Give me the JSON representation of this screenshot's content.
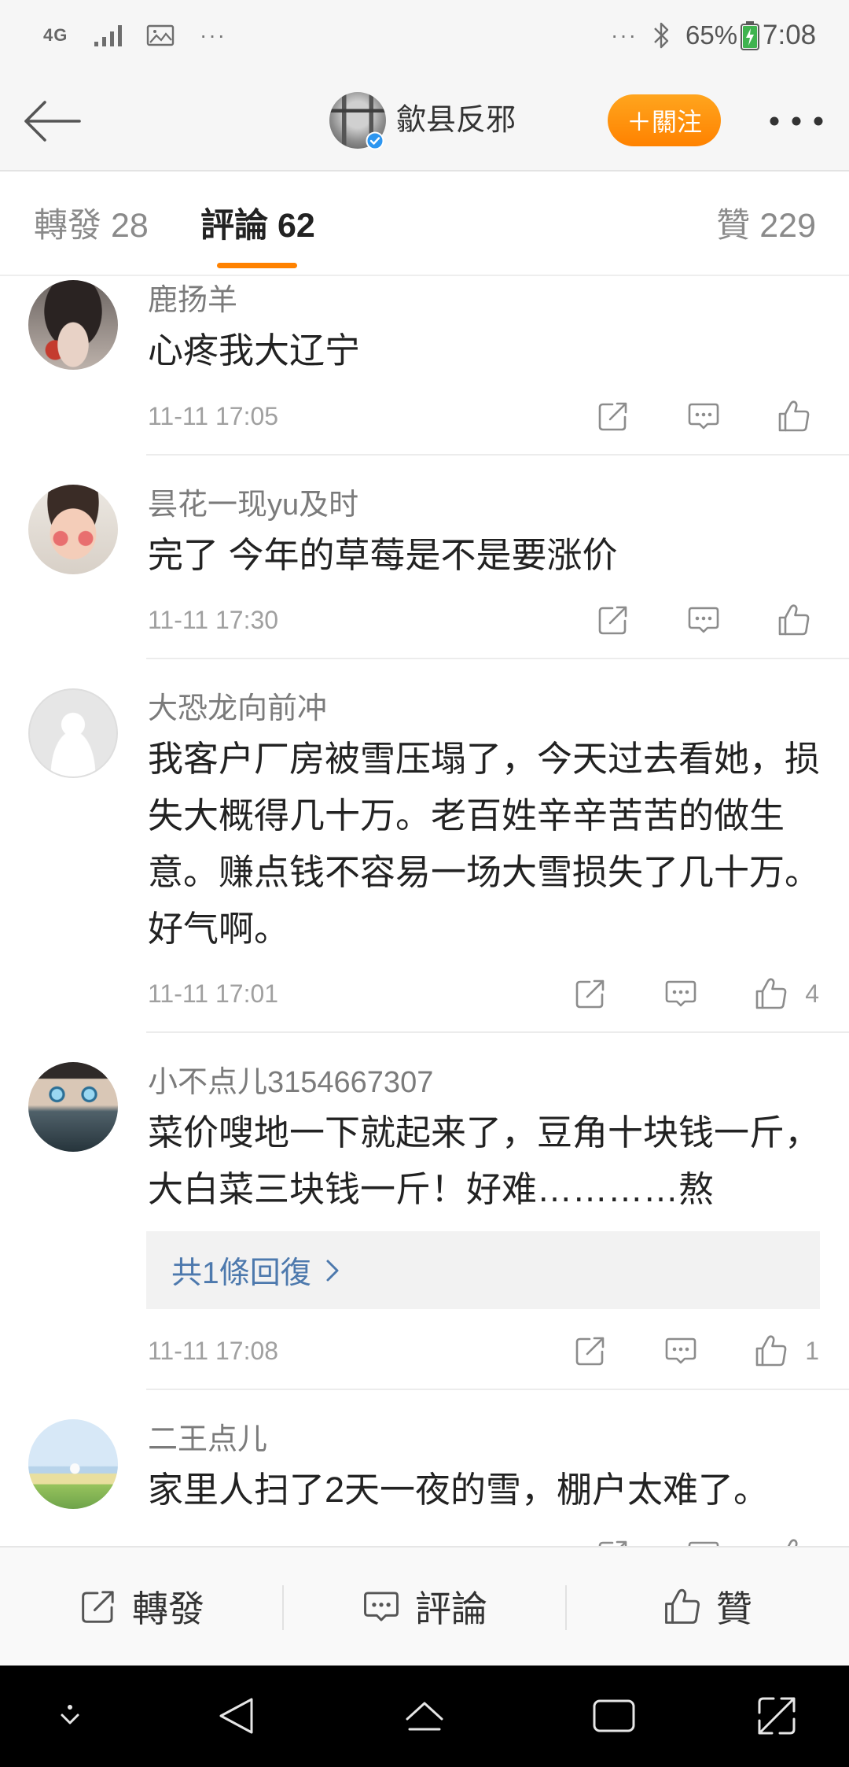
{
  "status_bar": {
    "network": "4G",
    "left_overflow": "···",
    "right_overflow": "···",
    "battery": "65%",
    "time": "7:08",
    "icons": [
      "signal-icon",
      "image-notification-icon",
      "bluetooth-icon",
      "battery-charging-icon"
    ]
  },
  "header": {
    "account_name": "歙县反邪",
    "follow_label": "＋關注",
    "verified": true,
    "icons": {
      "back": "back-arrow-icon",
      "more": "more-dots-icon",
      "verified": "verified-badge-icon"
    }
  },
  "tabs": [
    {
      "label": "轉發",
      "count": "28",
      "active": false
    },
    {
      "label": "評論",
      "count": "62",
      "active": true
    },
    {
      "label": "贊",
      "count": "229",
      "active": false
    }
  ],
  "comments": [
    {
      "name": "鹿扬羊",
      "lines": [
        "心疼我大辽宁"
      ],
      "time": "11-11 17:05"
    },
    {
      "name": "昙花一现yu及时",
      "lines": [
        "完了 今年的草莓是不是要涨价"
      ],
      "time": "11-11 17:30"
    },
    {
      "name": "大恐龙向前冲",
      "lines": [
        "我客户厂房被雪压塌了，今天过去看她，损",
        "失大概得几十万。老百姓辛辛苦苦的做生",
        "意。赚点钱不容易一场大雪损失了几十万。",
        "好气啊。"
      ],
      "time": "11-11 17:01",
      "likes": "4"
    },
    {
      "name": "小不点儿3154667307",
      "lines": [
        "菜价嗖地一下就起来了，豆角十块钱一斤，",
        "大白菜三块钱一斤！好难…………熬"
      ],
      "reply_link": "共1條回復",
      "time": "11-11 17:08",
      "likes": "1"
    },
    {
      "name": "二王点儿",
      "lines": [
        "家里人扫了2天一夜的雪，棚户太难了。"
      ]
    }
  ],
  "comment_action_icons": [
    "share-icon",
    "comment-icon",
    "like-icon"
  ],
  "bottom_bar": {
    "repost": "轉發",
    "comment": "評論",
    "like": "贊"
  },
  "nav_bar": {
    "icons": [
      "hide-nav-icon",
      "back-icon",
      "home-icon",
      "recents-icon",
      "expand-icon"
    ]
  },
  "colors": {
    "accent": "#ff8200",
    "link": "#4d79ad",
    "verified": "#2d96f0"
  }
}
